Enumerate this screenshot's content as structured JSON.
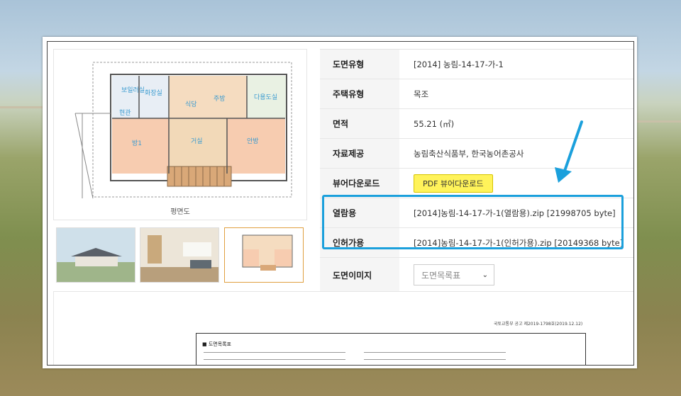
{
  "info": {
    "rows": [
      {
        "label": "도면유형",
        "value": "[2014] 농림-14-17-가-1"
      },
      {
        "label": "주택유형",
        "value": "목조"
      },
      {
        "label": "면적",
        "value": "55.21 (㎡)"
      },
      {
        "label": "자료제공",
        "value": "농림축산식품부, 한국농어촌공사"
      },
      {
        "label": "뷰어다운로드",
        "button": "PDF 뷰어다운로드"
      },
      {
        "label": "열람용",
        "value": "[2014]농림-14-17-가-1(열람용).zip [21998705 byte]"
      },
      {
        "label": "인허가용",
        "value": "[2014]농림-14-17-가-1(인허가용).zip [20149368 byte]"
      },
      {
        "label": "도면이미지",
        "select": "도면목록표"
      }
    ]
  },
  "plan": {
    "caption": "평면도",
    "rooms": {
      "bath1": "보일러실",
      "bath2": "화장실",
      "kitchen": "주방",
      "dining": "식당",
      "deck": "다용도실",
      "entry": "현관",
      "room1": "방1",
      "living": "거실",
      "master": "안방"
    }
  },
  "doc": {
    "title": "■ 도면목록표",
    "note": "국토교통부 공고 제2019-1798호(2019.12.12)"
  },
  "colors": {
    "highlight": "#1ba0dc",
    "pdf_button": "#fff35a",
    "arrow": "#1ba0dc"
  }
}
